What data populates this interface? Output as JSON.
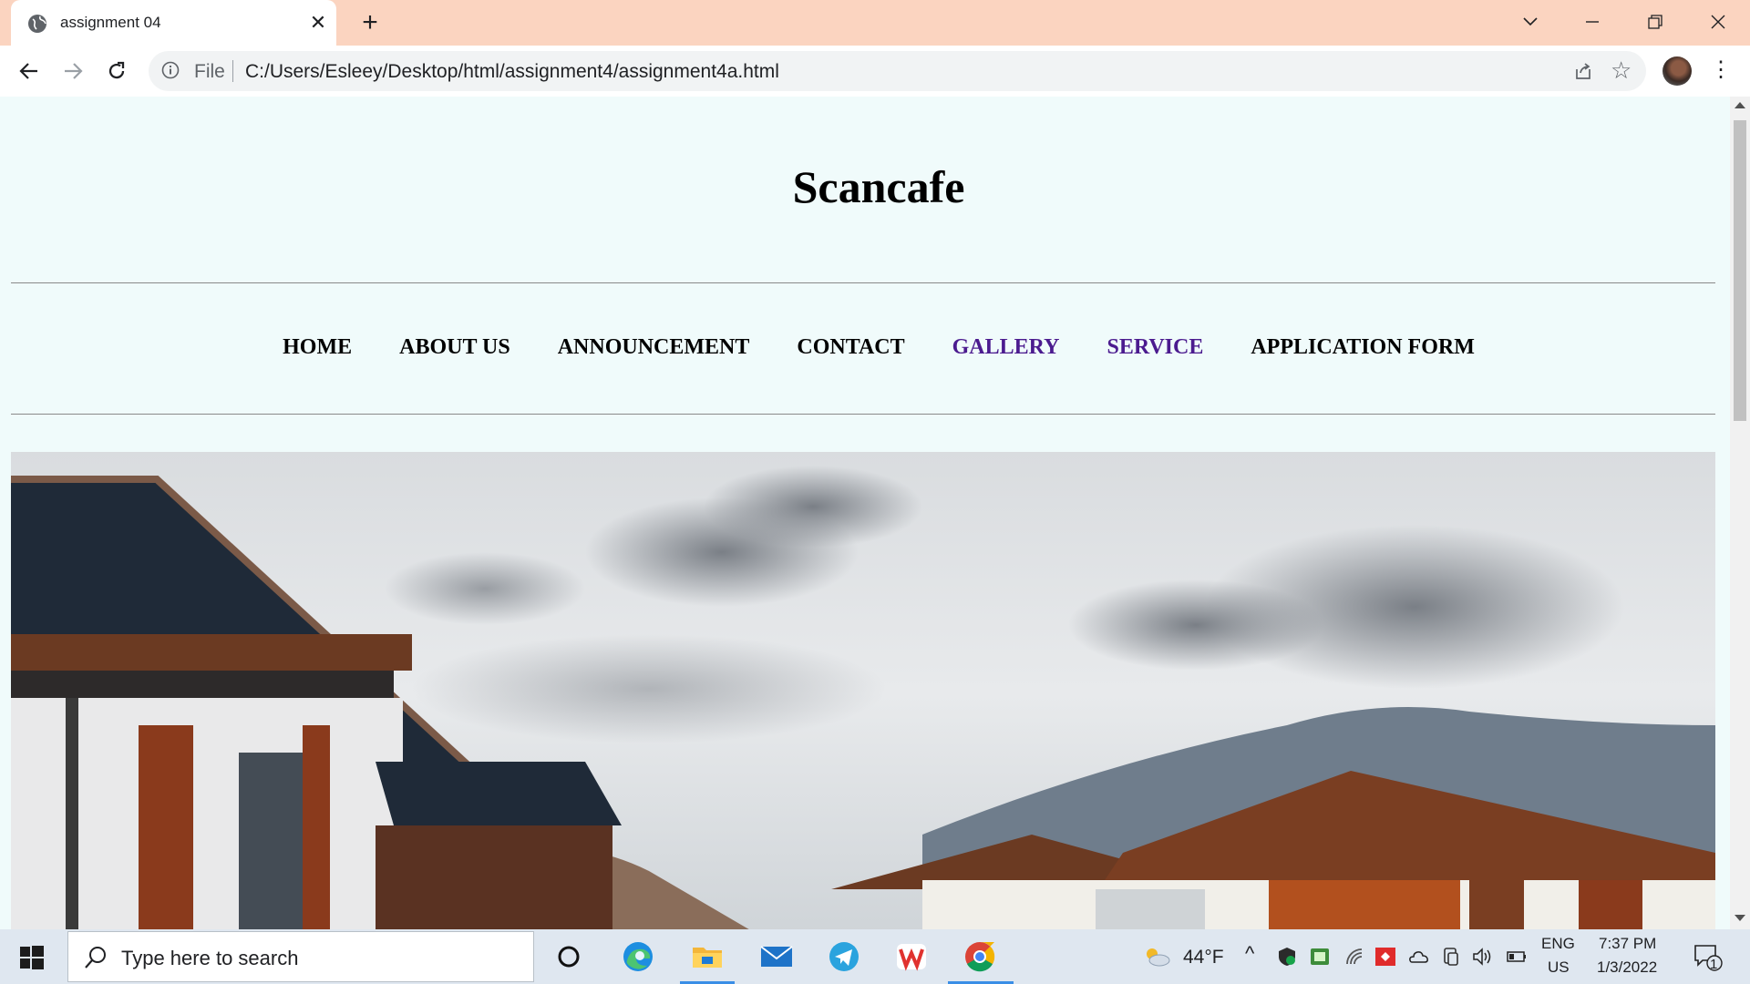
{
  "browser": {
    "tab_title": "assignment 04",
    "omnibox": {
      "scheme_label": "File",
      "url": "C:/Users/Esleey/Desktop/html/assignment4/assignment4a.html"
    }
  },
  "page": {
    "site_title": "Scancafe",
    "nav": [
      {
        "label": "HOME",
        "visited": false
      },
      {
        "label": "ABOUT US",
        "visited": false
      },
      {
        "label": "ANNOUNCEMENT",
        "visited": false
      },
      {
        "label": "CONTACT",
        "visited": false
      },
      {
        "label": "GALLERY",
        "visited": true
      },
      {
        "label": "SERVICE",
        "visited": true
      },
      {
        "label": "APPLICATION FORM",
        "visited": false
      }
    ],
    "link_colors": {
      "default": "#000000",
      "visited": "#4b1b8f"
    }
  },
  "taskbar": {
    "search_placeholder": "Type here to search",
    "weather": "44°F",
    "language": "ENG",
    "region": "US",
    "time": "7:37 PM",
    "date": "1/3/2022",
    "notification_count": "1"
  },
  "colors": {
    "titlebar": "#fbd4c0",
    "page_background": "#f0fbfb"
  }
}
